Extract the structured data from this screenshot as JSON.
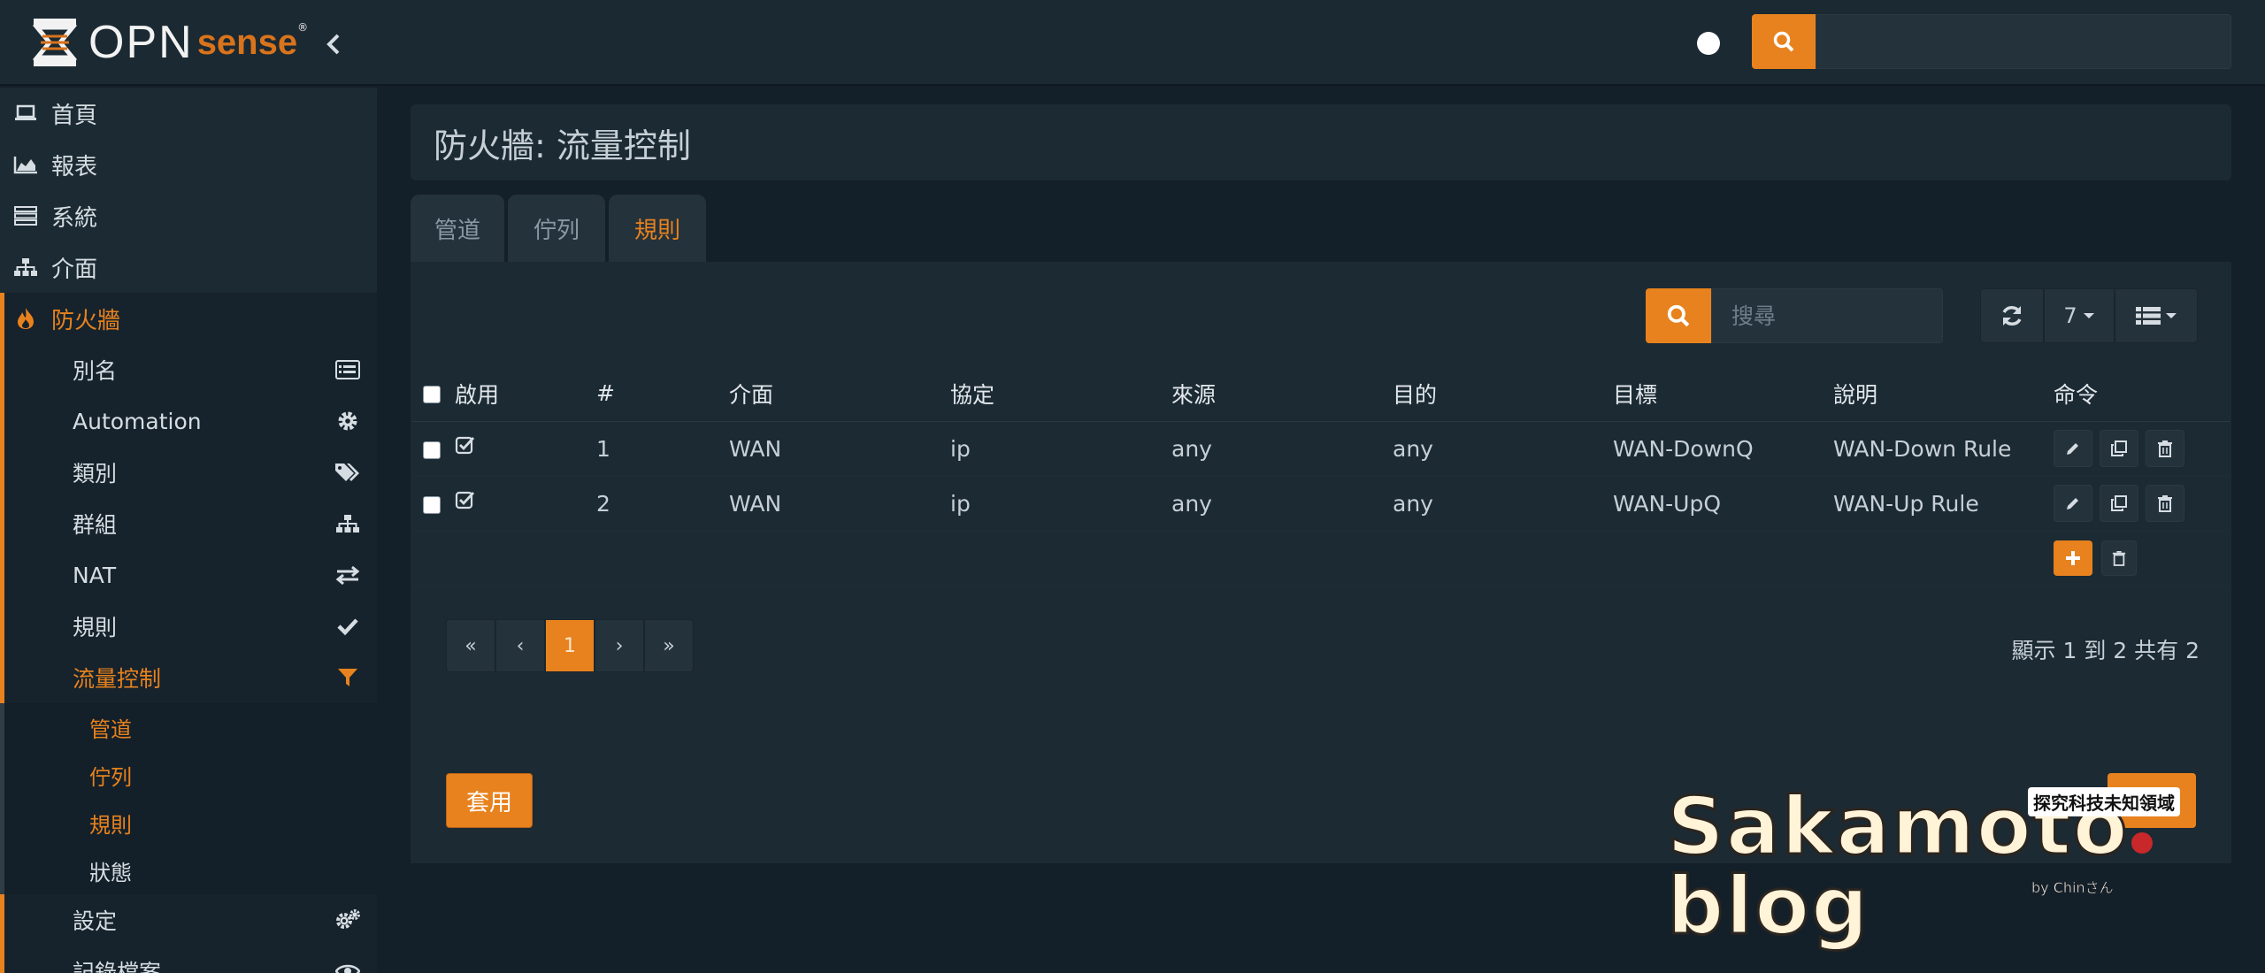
{
  "brand": {
    "word": "OPN",
    "accent": "sense",
    "reg": "®"
  },
  "search": {
    "placeholder": ""
  },
  "sidebar": {
    "top_items": [
      {
        "label": "首頁",
        "icon": "laptop-icon"
      },
      {
        "label": "報表",
        "icon": "area-chart-icon"
      },
      {
        "label": "系統",
        "icon": "server-icon"
      },
      {
        "label": "介面",
        "icon": "sitemap-icon"
      }
    ],
    "firewall": {
      "label": "防火牆",
      "icon": "fire-icon"
    },
    "firewall_items": [
      {
        "label": "別名",
        "icon": "list-alt-icon"
      },
      {
        "label": "Automation",
        "icon": "gear-icon"
      },
      {
        "label": "類別",
        "icon": "tags-icon"
      },
      {
        "label": "群組",
        "icon": "sitemap-icon"
      },
      {
        "label": "NAT",
        "icon": "exchange-icon"
      },
      {
        "label": "規則",
        "icon": "check-icon"
      },
      {
        "label": "流量控制",
        "icon": "filter-icon"
      }
    ],
    "shaper_items": [
      {
        "label": "管道"
      },
      {
        "label": "佇列"
      },
      {
        "label": "規則"
      },
      {
        "label": "狀態"
      }
    ],
    "settings": {
      "label": "設定",
      "icon": "gears-icon"
    },
    "logs": {
      "label": "記錄檔案",
      "icon": "eye-icon"
    }
  },
  "page": {
    "title": "防火牆: 流量控制"
  },
  "tabs": [
    {
      "label": "管道"
    },
    {
      "label": "佇列"
    },
    {
      "label": "規則"
    }
  ],
  "toolbar": {
    "search_placeholder": "搜尋",
    "page_size": "7"
  },
  "table": {
    "headers": {
      "enabled": "啟用",
      "sequence": "#",
      "interface": "介面",
      "proto": "協定",
      "source": "來源",
      "destination": "目的",
      "target": "目標",
      "description": "說明",
      "commands": "命令"
    },
    "rows": [
      {
        "seq": "1",
        "interface": "WAN",
        "proto": "ip",
        "source": "any",
        "destination": "any",
        "target": "WAN-DownQ",
        "description": "WAN-Down Rule"
      },
      {
        "seq": "2",
        "interface": "WAN",
        "proto": "ip",
        "source": "any",
        "destination": "any",
        "target": "WAN-UpQ",
        "description": "WAN-Up Rule"
      }
    ]
  },
  "pagination": {
    "first": "«",
    "prev": "‹",
    "current": "1",
    "next": "›",
    "last": "»",
    "info": "顯示 1 到 2 共有 2"
  },
  "actions": {
    "apply": "套用"
  },
  "watermark": {
    "name": "Sakamoto",
    "suffix": "blog",
    "tag": "探究科技未知領域",
    "by": "by Chinさん"
  },
  "colors": {
    "accent": "#e8821e",
    "background": "#142029",
    "panel": "#1c2a33"
  }
}
